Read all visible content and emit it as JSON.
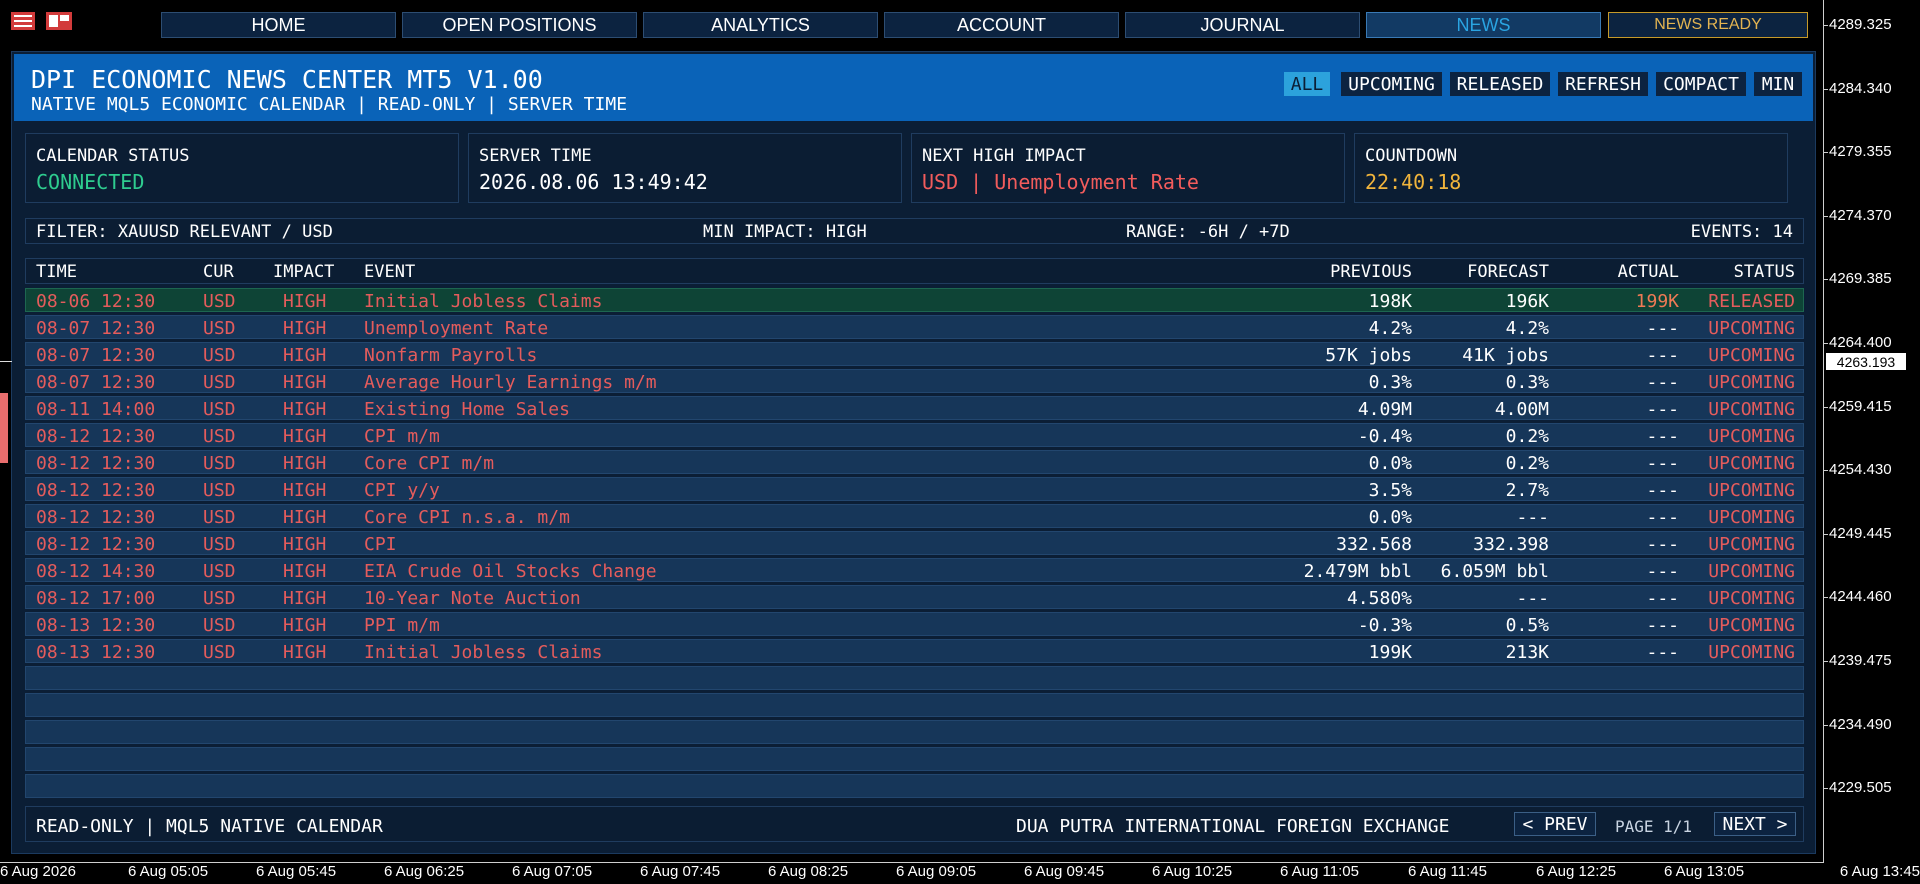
{
  "nav": {
    "items": [
      "HOME",
      "OPEN POSITIONS",
      "ANALYTICS",
      "ACCOUNT",
      "JOURNAL",
      "NEWS"
    ],
    "active": "NEWS",
    "ready_label": "NEWS READY"
  },
  "header": {
    "title": "DPI ECONOMIC NEWS CENTER MT5 V1.00",
    "subtitle": "NATIVE MQL5 ECONOMIC CALENDAR | READ-ONLY | SERVER TIME",
    "buttons": [
      "ALL",
      "UPCOMING",
      "RELEASED",
      "REFRESH",
      "COMPACT",
      "MIN"
    ],
    "active_button": "ALL"
  },
  "cards": [
    {
      "label": "CALENDAR STATUS",
      "value": "CONNECTED",
      "color": "#2ecc8f"
    },
    {
      "label": "SERVER TIME",
      "value": "2026.08.06 13:49:42",
      "color": "#ffffff"
    },
    {
      "label": "NEXT HIGH IMPACT",
      "value": "USD | Unemployment Rate",
      "color": "#f25c5c"
    },
    {
      "label": "COUNTDOWN",
      "value": "22:40:18",
      "color": "#f0b43c"
    }
  ],
  "filter": {
    "filter": "FILTER: XAUUSD RELEVANT / USD",
    "impact": "MIN IMPACT: HIGH",
    "range": "RANGE: -6H / +7D",
    "events": "EVENTS: 14"
  },
  "table": {
    "headers": {
      "time": "TIME",
      "cur": "CUR",
      "impact": "IMPACT",
      "event": "EVENT",
      "previous": "PREVIOUS",
      "forecast": "FORECAST",
      "actual": "ACTUAL",
      "status": "STATUS"
    },
    "rows": [
      {
        "time": "08-06 12:30",
        "cur": "USD",
        "impact": "HIGH",
        "event": "Initial Jobless Claims",
        "previous": "198K",
        "forecast": "196K",
        "actual": "199K",
        "status": "RELEASED"
      },
      {
        "time": "08-07 12:30",
        "cur": "USD",
        "impact": "HIGH",
        "event": "Unemployment Rate",
        "previous": "4.2%",
        "forecast": "4.2%",
        "actual": "---",
        "status": "UPCOMING"
      },
      {
        "time": "08-07 12:30",
        "cur": "USD",
        "impact": "HIGH",
        "event": "Nonfarm Payrolls",
        "previous": "57K jobs",
        "forecast": "41K jobs",
        "actual": "---",
        "status": "UPCOMING"
      },
      {
        "time": "08-07 12:30",
        "cur": "USD",
        "impact": "HIGH",
        "event": "Average Hourly Earnings m/m",
        "previous": "0.3%",
        "forecast": "0.3%",
        "actual": "---",
        "status": "UPCOMING"
      },
      {
        "time": "08-11 14:00",
        "cur": "USD",
        "impact": "HIGH",
        "event": "Existing Home Sales",
        "previous": "4.09M",
        "forecast": "4.00M",
        "actual": "---",
        "status": "UPCOMING"
      },
      {
        "time": "08-12 12:30",
        "cur": "USD",
        "impact": "HIGH",
        "event": "CPI m/m",
        "previous": "-0.4%",
        "forecast": "0.2%",
        "actual": "---",
        "status": "UPCOMING"
      },
      {
        "time": "08-12 12:30",
        "cur": "USD",
        "impact": "HIGH",
        "event": "Core CPI m/m",
        "previous": "0.0%",
        "forecast": "0.2%",
        "actual": "---",
        "status": "UPCOMING"
      },
      {
        "time": "08-12 12:30",
        "cur": "USD",
        "impact": "HIGH",
        "event": "CPI y/y",
        "previous": "3.5%",
        "forecast": "2.7%",
        "actual": "---",
        "status": "UPCOMING"
      },
      {
        "time": "08-12 12:30",
        "cur": "USD",
        "impact": "HIGH",
        "event": "Core CPI n.s.a. m/m",
        "previous": "0.0%",
        "forecast": "---",
        "actual": "---",
        "status": "UPCOMING"
      },
      {
        "time": "08-12 12:30",
        "cur": "USD",
        "impact": "HIGH",
        "event": "CPI",
        "previous": "332.568",
        "forecast": "332.398",
        "actual": "---",
        "status": "UPCOMING"
      },
      {
        "time": "08-12 14:30",
        "cur": "USD",
        "impact": "HIGH",
        "event": "EIA Crude Oil Stocks Change",
        "previous": "2.479M bbl",
        "forecast": "6.059M bbl",
        "actual": "---",
        "status": "UPCOMING"
      },
      {
        "time": "08-12 17:00",
        "cur": "USD",
        "impact": "HIGH",
        "event": "10-Year Note Auction",
        "previous": "4.580%",
        "forecast": "---",
        "actual": "---",
        "status": "UPCOMING"
      },
      {
        "time": "08-13 12:30",
        "cur": "USD",
        "impact": "HIGH",
        "event": "PPI m/m",
        "previous": "-0.3%",
        "forecast": "0.5%",
        "actual": "---",
        "status": "UPCOMING"
      },
      {
        "time": "08-13 12:30",
        "cur": "USD",
        "impact": "HIGH",
        "event": "Initial Jobless Claims",
        "previous": "199K",
        "forecast": "213K",
        "actual": "---",
        "status": "UPCOMING"
      }
    ],
    "empty_rows": 5
  },
  "footer": {
    "left": "READ-ONLY | MQL5 NATIVE CALENDAR",
    "company": "DUA PUTRA INTERNATIONAL FOREIGN EXCHANGE",
    "prev": "< PREV",
    "page": "PAGE 1/1",
    "next": "NEXT >"
  },
  "price_axis": {
    "labels": [
      "4289.325",
      "4284.340",
      "4279.355",
      "4274.370",
      "4269.385",
      "4264.400",
      "4259.415",
      "4254.430",
      "4249.445",
      "4244.460",
      "4239.475",
      "4234.490",
      "4229.505"
    ],
    "current": "4263.193"
  },
  "time_axis": [
    "6 Aug 2026",
    "6 Aug 05:05",
    "6 Aug 05:45",
    "6 Aug 06:25",
    "6 Aug 07:05",
    "6 Aug 07:45",
    "6 Aug 08:25",
    "6 Aug 09:05",
    "6 Aug 09:45",
    "6 Aug 10:25",
    "6 Aug 11:05",
    "6 Aug 11:45",
    "6 Aug 12:25",
    "6 Aug 13:05",
    "6 Aug 13:45"
  ],
  "colors": {
    "accent": "#0a63b8",
    "high": "#e45c5c",
    "released_actual": "#f07a55",
    "ready": "#e3b451"
  },
  "icons": [
    "menu-icon",
    "chart-window-icon"
  ]
}
